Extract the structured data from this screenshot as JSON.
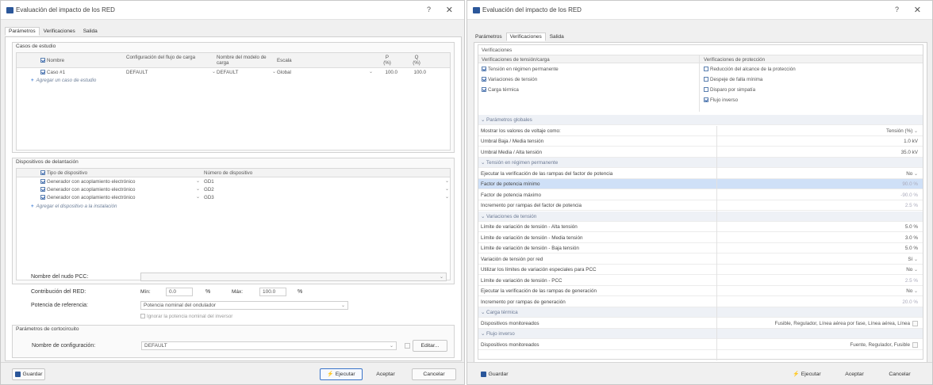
{
  "left": {
    "title": "Evaluación del impacto de los RED",
    "help": "?",
    "close": "✕",
    "tabs": [
      "Parámetros",
      "Verificaciones",
      "Salida"
    ],
    "study_cases": {
      "title": "Casos de estudio",
      "headers": {
        "name": "Nombre",
        "load_flow": "Configuración del flujo de carga",
        "model_name": "Nombre del modelo de carga",
        "scale": "Escala",
        "p": "P (%)",
        "q": "Q (%)"
      },
      "rows": [
        {
          "name": "Caso #1",
          "load_flow": "DEFAULT",
          "model_name": "DEFAULT",
          "scale": "Global",
          "p": "100.0",
          "q": "100.0"
        }
      ],
      "add_label": "Agregar un caso de estudio"
    },
    "devices": {
      "title": "Dispositivos de delantación",
      "headers": {
        "type": "Tipo de dispositivo",
        "number": "Número de dispositivo"
      },
      "rows": [
        {
          "type": "Generador con acoplamiento electrónico",
          "number": "GD1"
        },
        {
          "type": "Generador con acoplamiento electrónico",
          "number": "GD2"
        },
        {
          "type": "Generador con acoplamiento electrónico",
          "number": "GD3"
        }
      ],
      "add_label": "Agregar el dispositivo a la instalación"
    },
    "pcc_node_label": "Nombre del nudo PCC:",
    "red_contribution_label": "Contribución del RED:",
    "min_label": "Mín:",
    "min_value": "0.0",
    "pct": "%",
    "max_label": "Máx:",
    "max_value": "100.0",
    "ref_power_label": "Potencia de referencia:",
    "ref_power_value": "Potencia nominal del ondulador",
    "ignore_label": "Ignorar la potencia nominal del inversor",
    "sc": {
      "title": "Parámetros de cortocircuito",
      "config_label": "Nombre de configuración:",
      "config_value": "DEFAULT",
      "edit_label": "Editar..."
    },
    "buttons": {
      "save": "Guardar",
      "run": "Ejecutar",
      "accept": "Aceptar",
      "cancel": "Cancelar"
    }
  },
  "right": {
    "title": "Evaluación del impacto de los RED",
    "help": "?",
    "close": "✕",
    "tabs": [
      "Parámetros",
      "Verificaciones",
      "Salida"
    ],
    "verif_title": "Verificaciones",
    "col_left": "Verificaciones de tensión/carga",
    "col_right": "Verificaciones de protección",
    "left_checks": [
      {
        "label": "Tensión en régimen permanente",
        "checked": true
      },
      {
        "label": "Variaciones de tensión",
        "checked": true
      },
      {
        "label": "Carga térmica",
        "checked": true
      }
    ],
    "right_checks": [
      {
        "label": "Reducción del alcance de la protección",
        "checked": false
      },
      {
        "label": "Despeje de falla mínima",
        "checked": false
      },
      {
        "label": "Disparo por simpatía",
        "checked": false
      },
      {
        "label": "Flujo inverso",
        "checked": true
      }
    ],
    "rows": [
      {
        "kind": "sec",
        "label": "Parámetros globales"
      },
      {
        "label": "Mostrar los valores de voltaje como:",
        "value": "Tensión (%)",
        "dd": true
      },
      {
        "label": "Umbral Baja / Media tensión",
        "value": "1.0 kV"
      },
      {
        "label": "Umbral Media / Alta tensión",
        "value": "35.0 kV"
      },
      {
        "kind": "sec",
        "label": "Tensión en régimen permanente"
      },
      {
        "label": "Ejecutar la verificación de las rampas del factor de potencia",
        "value": "No",
        "dd": true
      },
      {
        "label": "Factor de potencia mínimo",
        "value": "90.0 %",
        "dim": true,
        "hl": true
      },
      {
        "label": "Factor de potencia máximo",
        "value": "-90.0 %",
        "dim": true
      },
      {
        "label": "Incremento por rampas del factor de potencia",
        "value": "2.5 %",
        "dim": true
      },
      {
        "kind": "sec",
        "label": "Variaciones de tensión"
      },
      {
        "label": "Límite de variación de tensión - Alta tensión",
        "value": "5.0 %"
      },
      {
        "label": "Límite de variación de tensión - Media tensión",
        "value": "3.0 %"
      },
      {
        "label": "Límite de variación de tensión - Baja tensión",
        "value": "5.0 %"
      },
      {
        "label": "Variación de tensión por red",
        "value": "Sí",
        "dd": true
      },
      {
        "label": "Utilizar los límites de variación especiales para PCC",
        "value": "No",
        "dd": true
      },
      {
        "label": "Límite de variación de tensión - PCC",
        "value": "2.5 %",
        "dim": true
      },
      {
        "label": "Ejecutar la verificación de las rampas de generación",
        "value": "No",
        "dd": true
      },
      {
        "label": "Incremento por rampas de generación",
        "value": "20.0 %",
        "dim": true
      },
      {
        "kind": "sec",
        "label": "Carga térmica"
      },
      {
        "label": "Dispositivos monitoreados",
        "value": "Fusible, Regulador, Línea aérea por fase, Línea aérea, Línea",
        "edit": true
      },
      {
        "kind": "sec",
        "label": "Flujo inverso"
      },
      {
        "label": "Dispositivos monitoreados",
        "value": "Fuente, Regulador, Fusible",
        "edit": true
      }
    ],
    "buttons": {
      "save": "Guardar",
      "run": "Ejecutar",
      "accept": "Aceptar",
      "cancel": "Cancelar"
    }
  }
}
